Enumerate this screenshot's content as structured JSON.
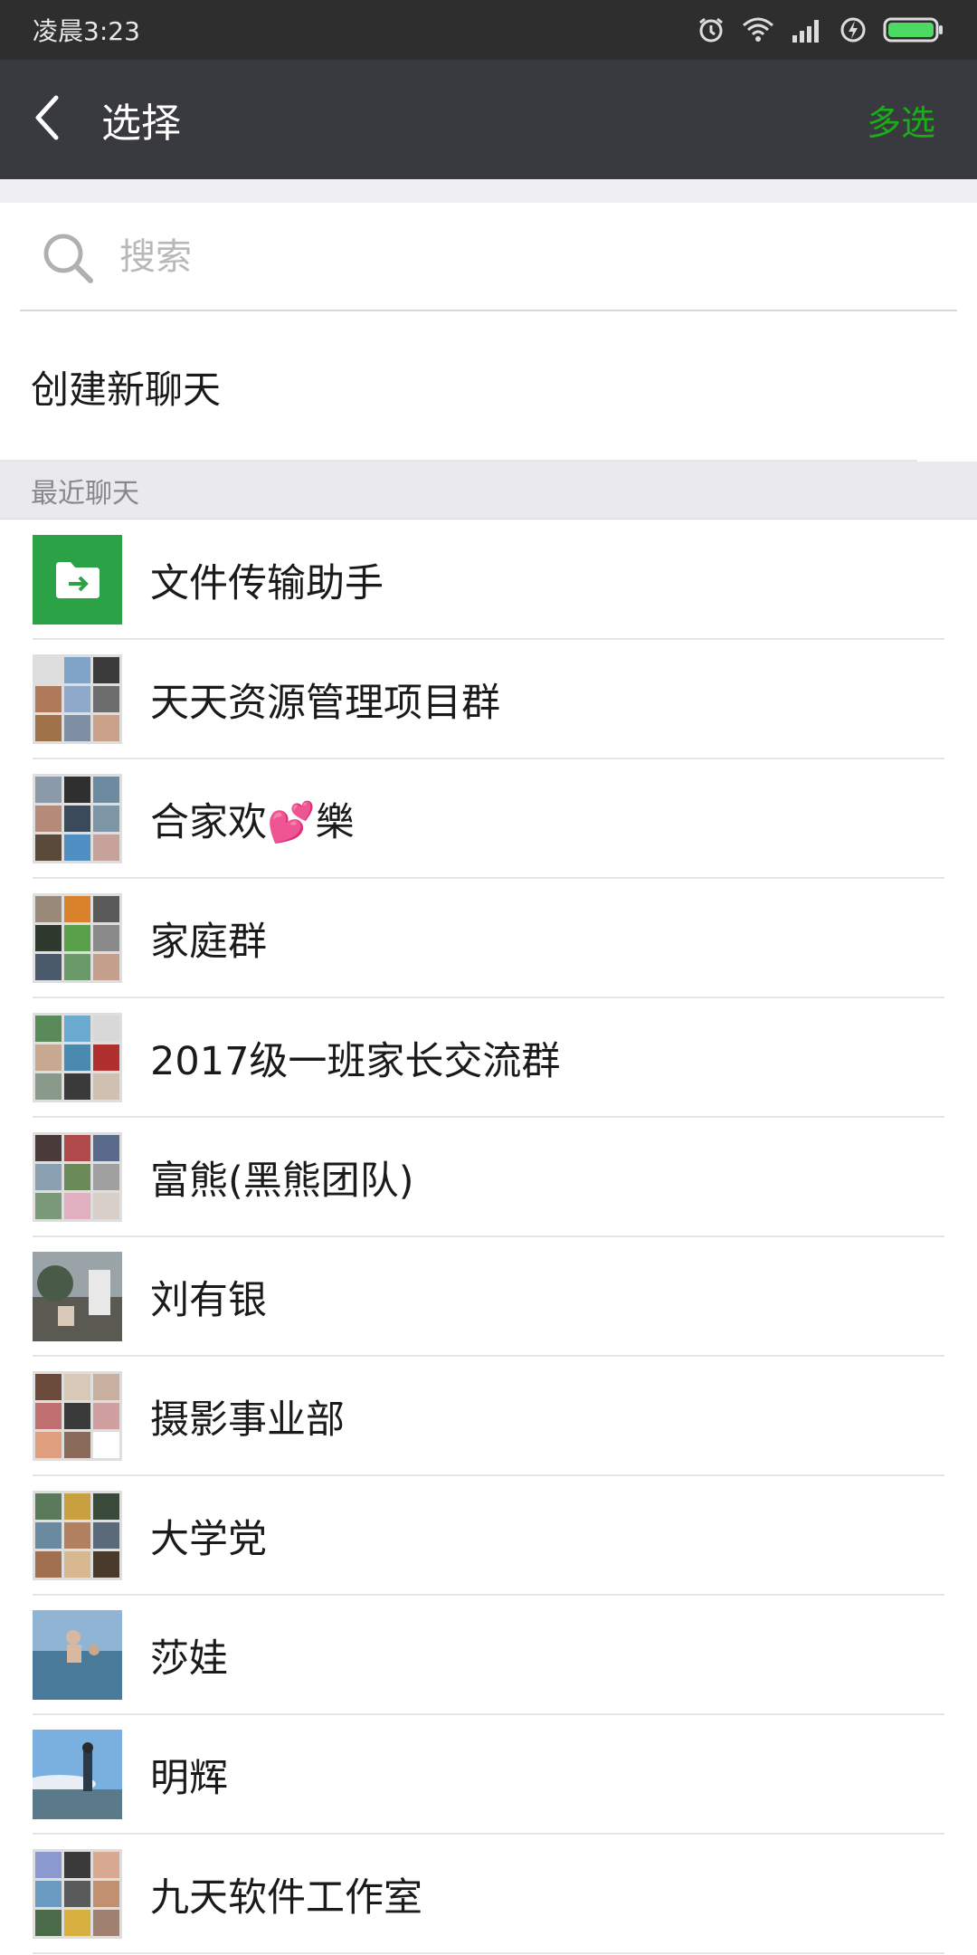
{
  "status_bar": {
    "time": "凌晨3:23",
    "icons": [
      "alarm-icon",
      "wifi-icon",
      "signal-icon",
      "charging-icon",
      "battery-icon"
    ],
    "battery_color": "#4cd964"
  },
  "header": {
    "title": "选择",
    "back_icon": "chevron-left-icon",
    "multi_select_label": "多选",
    "accent_color": "#1aad19"
  },
  "search": {
    "placeholder": "搜索",
    "value": ""
  },
  "create_chat": {
    "label": "创建新聊天"
  },
  "recent_section": {
    "label": "最近聊天"
  },
  "chats": [
    {
      "name": "文件传输助手",
      "avatar": "file-transfer-icon"
    },
    {
      "name": "天天资源管理项目群",
      "avatar": "group-avatar"
    },
    {
      "name": "合家欢💕樂",
      "avatar": "group-avatar"
    },
    {
      "name": "家庭群",
      "avatar": "group-avatar"
    },
    {
      "name": "2017级一班家长交流群",
      "avatar": "group-avatar"
    },
    {
      "name": "富熊(黑熊团队)",
      "avatar": "group-avatar"
    },
    {
      "name": "刘有银",
      "avatar": "photo-avatar"
    },
    {
      "name": "摄影事业部",
      "avatar": "group-avatar"
    },
    {
      "name": "大学党",
      "avatar": "group-avatar"
    },
    {
      "name": "莎娃",
      "avatar": "photo-avatar"
    },
    {
      "name": "明辉",
      "avatar": "photo-avatar"
    },
    {
      "name": "九天软件工作室",
      "avatar": "group-avatar"
    }
  ]
}
